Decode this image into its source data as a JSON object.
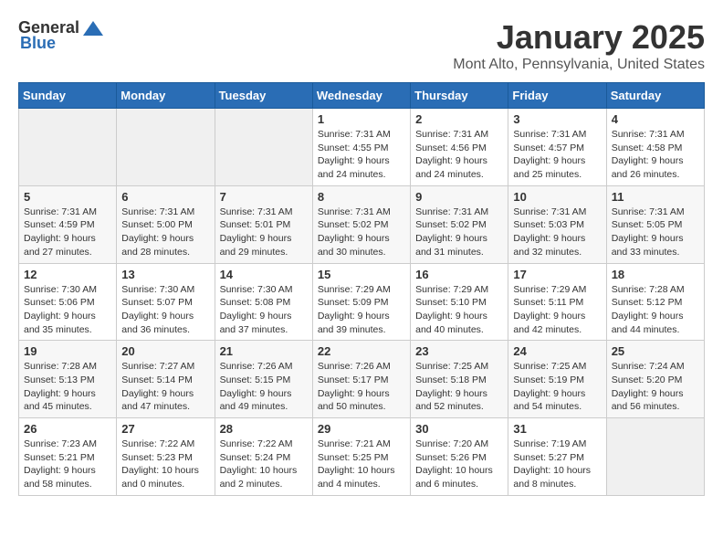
{
  "header": {
    "logo_general": "General",
    "logo_blue": "Blue",
    "month": "January 2025",
    "location": "Mont Alto, Pennsylvania, United States"
  },
  "weekdays": [
    "Sunday",
    "Monday",
    "Tuesday",
    "Wednesday",
    "Thursday",
    "Friday",
    "Saturday"
  ],
  "weeks": [
    [
      {
        "day": "",
        "sunrise": "",
        "sunset": "",
        "daylight": ""
      },
      {
        "day": "",
        "sunrise": "",
        "sunset": "",
        "daylight": ""
      },
      {
        "day": "",
        "sunrise": "",
        "sunset": "",
        "daylight": ""
      },
      {
        "day": "1",
        "sunrise": "Sunrise: 7:31 AM",
        "sunset": "Sunset: 4:55 PM",
        "daylight": "Daylight: 9 hours and 24 minutes."
      },
      {
        "day": "2",
        "sunrise": "Sunrise: 7:31 AM",
        "sunset": "Sunset: 4:56 PM",
        "daylight": "Daylight: 9 hours and 24 minutes."
      },
      {
        "day": "3",
        "sunrise": "Sunrise: 7:31 AM",
        "sunset": "Sunset: 4:57 PM",
        "daylight": "Daylight: 9 hours and 25 minutes."
      },
      {
        "day": "4",
        "sunrise": "Sunrise: 7:31 AM",
        "sunset": "Sunset: 4:58 PM",
        "daylight": "Daylight: 9 hours and 26 minutes."
      }
    ],
    [
      {
        "day": "5",
        "sunrise": "Sunrise: 7:31 AM",
        "sunset": "Sunset: 4:59 PM",
        "daylight": "Daylight: 9 hours and 27 minutes."
      },
      {
        "day": "6",
        "sunrise": "Sunrise: 7:31 AM",
        "sunset": "Sunset: 5:00 PM",
        "daylight": "Daylight: 9 hours and 28 minutes."
      },
      {
        "day": "7",
        "sunrise": "Sunrise: 7:31 AM",
        "sunset": "Sunset: 5:01 PM",
        "daylight": "Daylight: 9 hours and 29 minutes."
      },
      {
        "day": "8",
        "sunrise": "Sunrise: 7:31 AM",
        "sunset": "Sunset: 5:02 PM",
        "daylight": "Daylight: 9 hours and 30 minutes."
      },
      {
        "day": "9",
        "sunrise": "Sunrise: 7:31 AM",
        "sunset": "Sunset: 5:02 PM",
        "daylight": "Daylight: 9 hours and 31 minutes."
      },
      {
        "day": "10",
        "sunrise": "Sunrise: 7:31 AM",
        "sunset": "Sunset: 5:03 PM",
        "daylight": "Daylight: 9 hours and 32 minutes."
      },
      {
        "day": "11",
        "sunrise": "Sunrise: 7:31 AM",
        "sunset": "Sunset: 5:05 PM",
        "daylight": "Daylight: 9 hours and 33 minutes."
      }
    ],
    [
      {
        "day": "12",
        "sunrise": "Sunrise: 7:30 AM",
        "sunset": "Sunset: 5:06 PM",
        "daylight": "Daylight: 9 hours and 35 minutes."
      },
      {
        "day": "13",
        "sunrise": "Sunrise: 7:30 AM",
        "sunset": "Sunset: 5:07 PM",
        "daylight": "Daylight: 9 hours and 36 minutes."
      },
      {
        "day": "14",
        "sunrise": "Sunrise: 7:30 AM",
        "sunset": "Sunset: 5:08 PM",
        "daylight": "Daylight: 9 hours and 37 minutes."
      },
      {
        "day": "15",
        "sunrise": "Sunrise: 7:29 AM",
        "sunset": "Sunset: 5:09 PM",
        "daylight": "Daylight: 9 hours and 39 minutes."
      },
      {
        "day": "16",
        "sunrise": "Sunrise: 7:29 AM",
        "sunset": "Sunset: 5:10 PM",
        "daylight": "Daylight: 9 hours and 40 minutes."
      },
      {
        "day": "17",
        "sunrise": "Sunrise: 7:29 AM",
        "sunset": "Sunset: 5:11 PM",
        "daylight": "Daylight: 9 hours and 42 minutes."
      },
      {
        "day": "18",
        "sunrise": "Sunrise: 7:28 AM",
        "sunset": "Sunset: 5:12 PM",
        "daylight": "Daylight: 9 hours and 44 minutes."
      }
    ],
    [
      {
        "day": "19",
        "sunrise": "Sunrise: 7:28 AM",
        "sunset": "Sunset: 5:13 PM",
        "daylight": "Daylight: 9 hours and 45 minutes."
      },
      {
        "day": "20",
        "sunrise": "Sunrise: 7:27 AM",
        "sunset": "Sunset: 5:14 PM",
        "daylight": "Daylight: 9 hours and 47 minutes."
      },
      {
        "day": "21",
        "sunrise": "Sunrise: 7:26 AM",
        "sunset": "Sunset: 5:15 PM",
        "daylight": "Daylight: 9 hours and 49 minutes."
      },
      {
        "day": "22",
        "sunrise": "Sunrise: 7:26 AM",
        "sunset": "Sunset: 5:17 PM",
        "daylight": "Daylight: 9 hours and 50 minutes."
      },
      {
        "day": "23",
        "sunrise": "Sunrise: 7:25 AM",
        "sunset": "Sunset: 5:18 PM",
        "daylight": "Daylight: 9 hours and 52 minutes."
      },
      {
        "day": "24",
        "sunrise": "Sunrise: 7:25 AM",
        "sunset": "Sunset: 5:19 PM",
        "daylight": "Daylight: 9 hours and 54 minutes."
      },
      {
        "day": "25",
        "sunrise": "Sunrise: 7:24 AM",
        "sunset": "Sunset: 5:20 PM",
        "daylight": "Daylight: 9 hours and 56 minutes."
      }
    ],
    [
      {
        "day": "26",
        "sunrise": "Sunrise: 7:23 AM",
        "sunset": "Sunset: 5:21 PM",
        "daylight": "Daylight: 9 hours and 58 minutes."
      },
      {
        "day": "27",
        "sunrise": "Sunrise: 7:22 AM",
        "sunset": "Sunset: 5:23 PM",
        "daylight": "Daylight: 10 hours and 0 minutes."
      },
      {
        "day": "28",
        "sunrise": "Sunrise: 7:22 AM",
        "sunset": "Sunset: 5:24 PM",
        "daylight": "Daylight: 10 hours and 2 minutes."
      },
      {
        "day": "29",
        "sunrise": "Sunrise: 7:21 AM",
        "sunset": "Sunset: 5:25 PM",
        "daylight": "Daylight: 10 hours and 4 minutes."
      },
      {
        "day": "30",
        "sunrise": "Sunrise: 7:20 AM",
        "sunset": "Sunset: 5:26 PM",
        "daylight": "Daylight: 10 hours and 6 minutes."
      },
      {
        "day": "31",
        "sunrise": "Sunrise: 7:19 AM",
        "sunset": "Sunset: 5:27 PM",
        "daylight": "Daylight: 10 hours and 8 minutes."
      },
      {
        "day": "",
        "sunrise": "",
        "sunset": "",
        "daylight": ""
      }
    ]
  ]
}
